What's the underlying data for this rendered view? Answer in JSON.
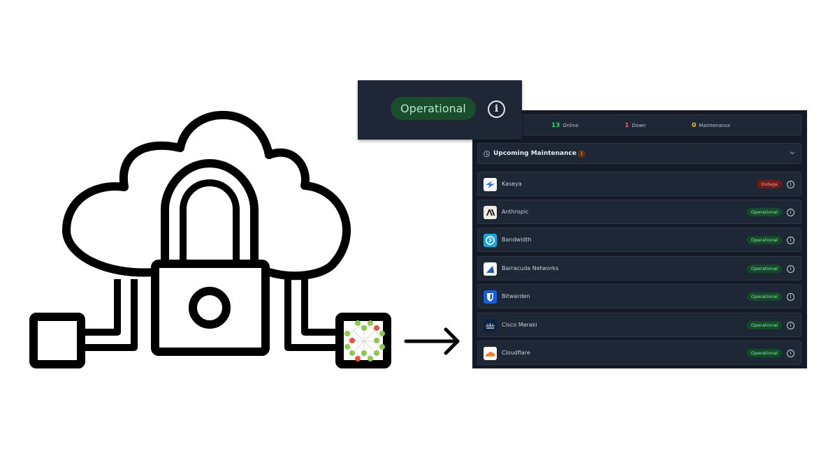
{
  "popout": {
    "status_label": "Operational",
    "info_icon": "info-icon"
  },
  "summary": {
    "online_count": "13",
    "online_label": "Online",
    "down_count": "1",
    "down_label": "Down",
    "maintenance_count": "0",
    "maintenance_label": "Maintenance"
  },
  "maintenance": {
    "title": "Upcoming Maintenance",
    "count": "1",
    "icon": "clock-icon",
    "toggle_icon": "chevron-down-icon"
  },
  "services": [
    {
      "name": "Kaseya",
      "status": "Outage",
      "logo": "kaseya-logo"
    },
    {
      "name": "Anthropic",
      "status": "Operational",
      "logo": "anthropic-logo"
    },
    {
      "name": "Bandwidth",
      "status": "Operational",
      "logo": "bandwidth-logo"
    },
    {
      "name": "Barracuda Networks",
      "status": "Operational",
      "logo": "barracuda-logo"
    },
    {
      "name": "Bitwarden",
      "status": "Operational",
      "logo": "bitwarden-logo"
    },
    {
      "name": "Cisco Meraki",
      "status": "Operational",
      "logo": "cisco-logo"
    },
    {
      "name": "Cloudflare",
      "status": "Operational",
      "logo": "cloudflare-logo"
    }
  ],
  "colors": {
    "online": "#3ecf6e",
    "down": "#ef5a5a",
    "maintenance": "#f2c230",
    "operational_badge": "#124a2a",
    "outage_badge": "#6d1a1a",
    "panel_bg": "#141b27"
  },
  "illustration": {
    "main_icon": "cloud-lock-icon",
    "arrow_icon": "arrow-right-icon"
  }
}
